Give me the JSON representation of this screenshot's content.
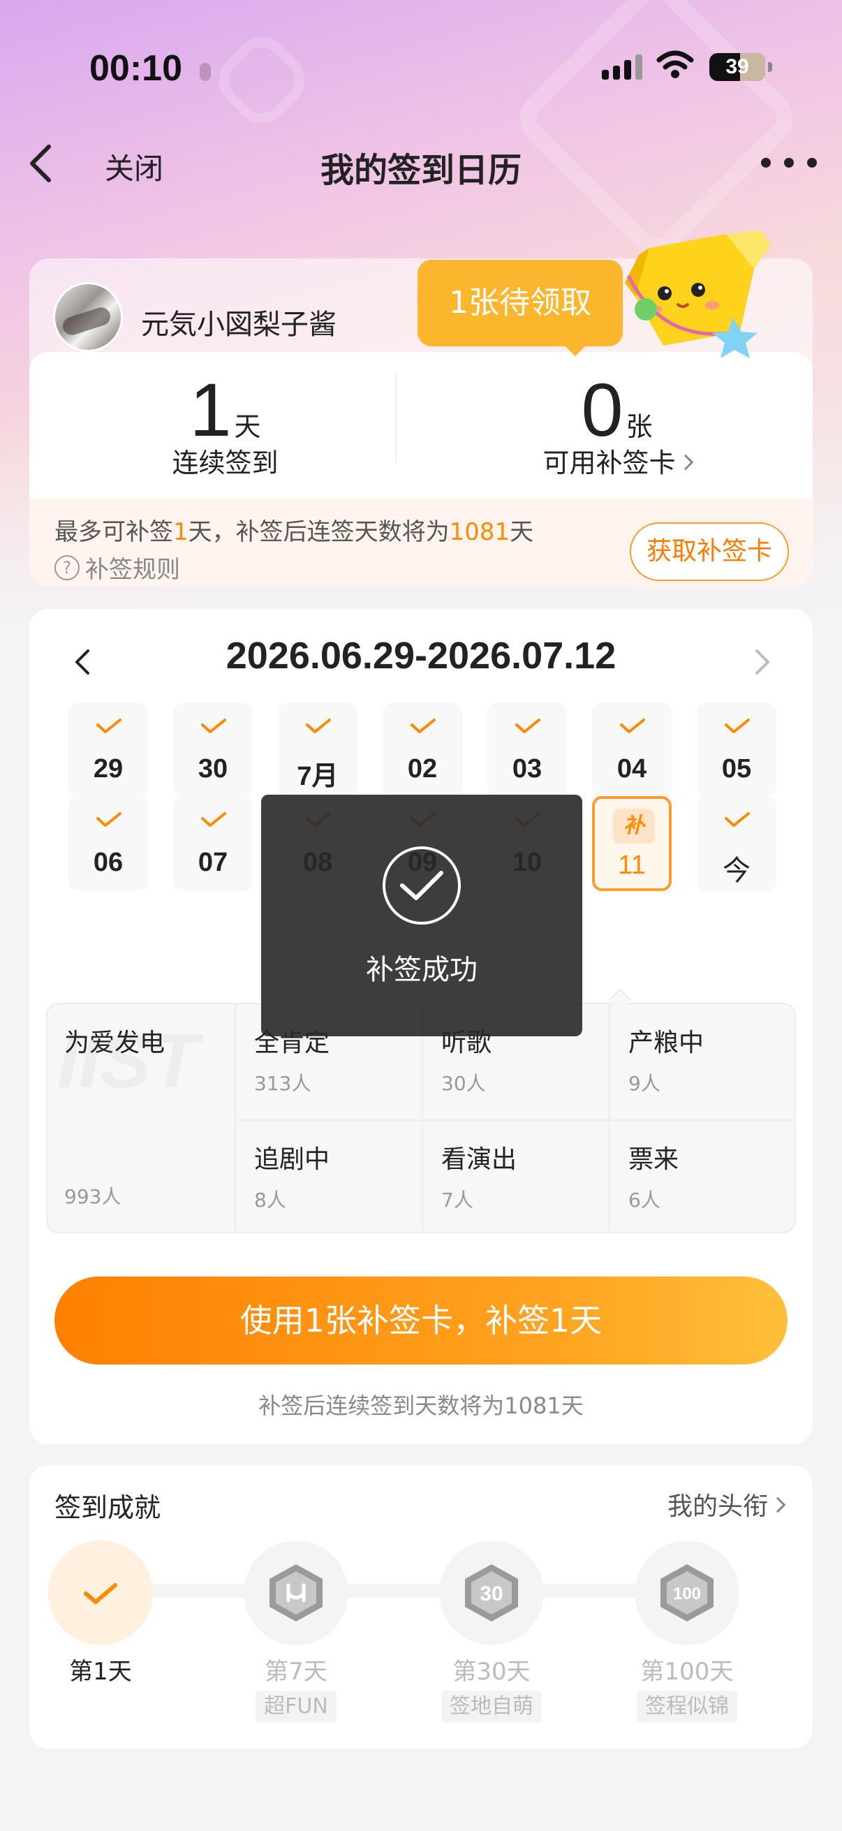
{
  "status_bar": {
    "time": "00:10",
    "battery": "39"
  },
  "nav": {
    "close_label": "关闭",
    "title": "我的签到日历"
  },
  "profile": {
    "username": "元気小図梨子酱",
    "tip": "1张待领取",
    "streak_value": "1",
    "streak_unit": "天",
    "streak_label": "连续签到",
    "cards_value": "0",
    "cards_unit": "张",
    "cards_label": "可用补签卡",
    "makeup_prefix": "最多可补签",
    "makeup_days": "1",
    "makeup_mid": "天，补签后连签天数将为",
    "makeup_total": "1081",
    "makeup_suffix": "天",
    "rules_label": "补签规则",
    "get_card_button": "获取补签卡"
  },
  "calendar": {
    "range": "2026.06.29-2026.07.12",
    "week1": [
      {
        "label": "29",
        "checked": true
      },
      {
        "label": "30",
        "checked": true
      },
      {
        "label": "7月",
        "checked": true
      },
      {
        "label": "02",
        "checked": true
      },
      {
        "label": "03",
        "checked": true
      },
      {
        "label": "04",
        "checked": true
      },
      {
        "label": "05",
        "checked": true
      }
    ],
    "week2": [
      {
        "label": "06",
        "checked": true
      },
      {
        "label": "07",
        "checked": true
      },
      {
        "label": "08",
        "checked": true
      },
      {
        "label": "09",
        "checked": true
      },
      {
        "label": "10",
        "checked": true
      },
      {
        "label": "11",
        "badge": "补",
        "selected": true
      },
      {
        "label": "今",
        "checked": true
      }
    ],
    "groups": [
      {
        "name": "为爱发电",
        "count": "993人"
      },
      {
        "name": "全肯定",
        "count": "313人"
      },
      {
        "name": "听歌",
        "count": "30人"
      },
      {
        "name": "产粮中",
        "count": "9人"
      },
      {
        "name": "追剧中",
        "count": "8人"
      },
      {
        "name": "看演出",
        "count": "7人"
      },
      {
        "name": "票来",
        "count": "6人"
      }
    ],
    "use_button": "使用1张补签卡，补签1天",
    "after_text": "补签后连续签到天数将为1081天"
  },
  "toast": {
    "text": "补签成功"
  },
  "achievements": {
    "title": "签到成就",
    "link": "我的头衔",
    "items": [
      {
        "label": "第1天",
        "tag": "",
        "done": true
      },
      {
        "label": "第7天",
        "tag": "超FUN",
        "done": false
      },
      {
        "label": "第30天",
        "tag": "签地自萌",
        "done": false
      },
      {
        "label": "第100天",
        "tag": "签程似锦",
        "done": false
      }
    ]
  },
  "colors": {
    "accent": "#ff8a00",
    "tip_bg": "#fbb62e",
    "toast_bg": "#282828"
  }
}
